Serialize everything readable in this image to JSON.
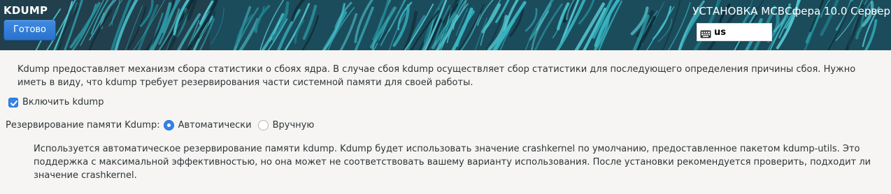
{
  "header": {
    "screen_title": "KDUMP",
    "done_label": "Готово",
    "product_title": "УСТАНОВКА МСВСфера 10.0 Сервер",
    "keyboard_layout": "us",
    "keyboard_icon": "keyboard-icon"
  },
  "main": {
    "description": "Kdump предоставляет механизм сбора статистики о сбоях ядра. В случае сбоя kdump осуществляет сбор статистики для последующего определения причины сбоя. Нужно иметь в виду, что kdump требует резервирования части системной памяти для своей работы.",
    "enable_checkbox": {
      "label": "Включить kdump",
      "checked": true
    },
    "reservation": {
      "label": "Резервирование памяти Kdump:",
      "options": [
        {
          "label": "Автоматически",
          "selected": true
        },
        {
          "label": "Вручную",
          "selected": false
        }
      ]
    },
    "auto_note": "Используется автоматическое резервирование памяти kdump. Kdump будет использовать значение crashkernel по умолчанию, предоставленное пакетом kdump-utils. Это поддержка с максимальной эффективностью, но она может не соответствовать вашему варианту использования. После установки рекомендуется проверить, подходит ли значение crashkernel."
  },
  "colors": {
    "accent": "#3584e4",
    "header_background": "#1e3d4a",
    "header_pattern": "#37b3c0",
    "page_background": "#f6f5f4"
  }
}
